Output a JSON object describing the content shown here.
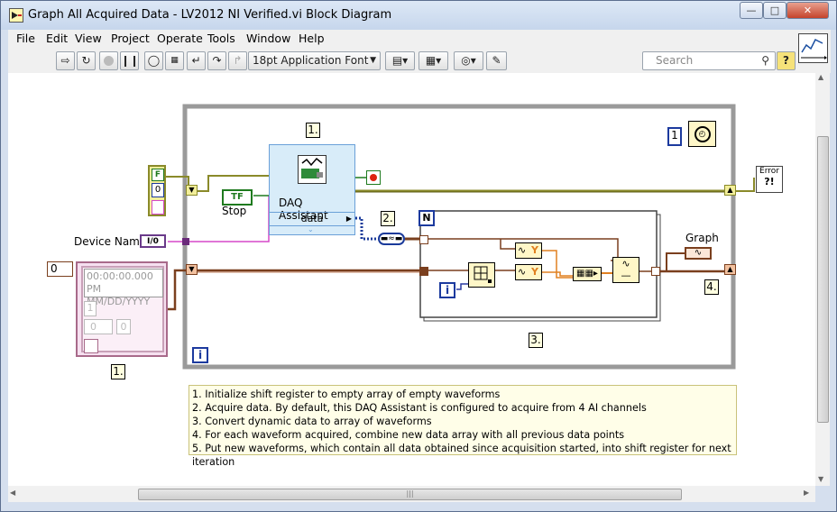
{
  "window": {
    "title": "Graph All Acquired Data - LV2012 NI Verified.vi Block Diagram"
  },
  "menu": [
    "File",
    "Edit",
    "View",
    "Project",
    "Operate",
    "Tools",
    "Window",
    "Help"
  ],
  "toolbar": {
    "font_selector": "18pt Application Font",
    "search_placeholder": "Search",
    "help": "?"
  },
  "diagram": {
    "labels": {
      "step1_top": "1.",
      "step1_bottom": "1.",
      "step2": "2.",
      "step3": "3.",
      "step4": "4.",
      "loop_count_n": "N",
      "iteration_i": "i",
      "iteration_i_inner": "i",
      "wait_const": "1",
      "device_name": "Device Name",
      "io_const": "I/0",
      "stop": "Stop",
      "stop_tf": "TF",
      "graph": "Graph",
      "daq_assistant": "DAQ Assistant",
      "daq_data": "data",
      "error": "Error",
      "error_sym": "?!",
      "bool_f": "F",
      "cluster_num": "0",
      "array_index": "0",
      "timestamp": "00:00:00.000 PM",
      "date": "MM/DD/YYYY",
      "wf_dt": "1",
      "wf_zero1": "0",
      "wf_zero2": "0",
      "y1": "Y",
      "y2": "Y"
    },
    "comments": [
      "1. Initialize shift register to empty array of empty waveforms",
      "2. Acquire data.  By default, this DAQ Assistant is configured to acquire from 4 AI channels",
      "3. Convert dynamic data to array of waveforms",
      "4. For each waveform acquired, combine new data array with all previous data points",
      "5. Put new waveforms, which contain all data obtained since acquisition started, into shift register for next iteration"
    ]
  },
  "colors": {
    "while_loop": "#9a9a9a",
    "for_loop": "#555555",
    "wire_waveform": "#7a3f1e",
    "wire_string": "#d548c8",
    "wire_bool": "#1e7a1e",
    "wire_error": "#8a8a2a",
    "daq_fill": "#d8ecf9"
  }
}
